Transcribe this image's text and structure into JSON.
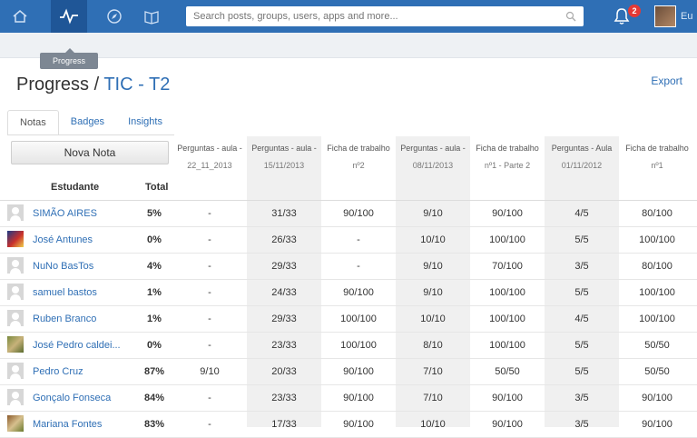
{
  "nav": {
    "tooltip": "Progress",
    "search_placeholder": "Search posts, groups, users, apps and more...",
    "notification_count": "2",
    "user_label": "Eu"
  },
  "page": {
    "title_prefix": "Progress / ",
    "course": "TIC - T2",
    "export_label": "Export",
    "nova_nota_label": "Nova Nota"
  },
  "tabs": [
    "Notas",
    "Badges",
    "Insights"
  ],
  "table": {
    "student_header": "Estudante",
    "total_header": "Total",
    "columns": [
      {
        "title": "Perguntas - aula -",
        "sub": "22_11_2013"
      },
      {
        "title": "Perguntas - aula -",
        "sub": "15/11/2013"
      },
      {
        "title": "Ficha de trabalho",
        "sub": "nº2"
      },
      {
        "title": "Perguntas - aula -",
        "sub": "08/11/2013"
      },
      {
        "title": "Ficha de trabalho",
        "sub": "nº1 - Parte 2"
      },
      {
        "title": "Perguntas - Aula",
        "sub": "01/11/2012"
      },
      {
        "title": "Ficha de trabalho",
        "sub": "nº1"
      }
    ],
    "rows": [
      {
        "name": "SIMÃO AIRES",
        "total": "5%",
        "avatar": "default",
        "scores": [
          "-",
          "31/33",
          "90/100",
          "9/10",
          "90/100",
          "4/5",
          "80/100"
        ]
      },
      {
        "name": "José Antunes",
        "total": "0%",
        "avatar": "photo2",
        "scores": [
          "-",
          "26/33",
          "-",
          "10/10",
          "100/100",
          "5/5",
          "100/100"
        ]
      },
      {
        "name": "NuNo BasTos",
        "total": "4%",
        "avatar": "default",
        "scores": [
          "-",
          "29/33",
          "-",
          "9/10",
          "70/100",
          "3/5",
          "80/100"
        ]
      },
      {
        "name": "samuel bastos",
        "total": "1%",
        "avatar": "default",
        "scores": [
          "-",
          "24/33",
          "90/100",
          "9/10",
          "100/100",
          "5/5",
          "100/100"
        ]
      },
      {
        "name": "Ruben Branco",
        "total": "1%",
        "avatar": "default",
        "scores": [
          "-",
          "29/33",
          "100/100",
          "10/10",
          "100/100",
          "4/5",
          "100/100"
        ]
      },
      {
        "name": "José Pedro caldei...",
        "total": "0%",
        "avatar": "photo",
        "scores": [
          "-",
          "23/33",
          "100/100",
          "8/10",
          "100/100",
          "5/5",
          "50/50"
        ]
      },
      {
        "name": "Pedro Cruz",
        "total": "87%",
        "avatar": "default",
        "scores": [
          "9/10",
          "20/33",
          "90/100",
          "7/10",
          "50/50",
          "5/5",
          "50/50"
        ]
      },
      {
        "name": "Gonçalo Fonseca",
        "total": "84%",
        "avatar": "default",
        "scores": [
          "-",
          "23/33",
          "90/100",
          "7/10",
          "90/100",
          "3/5",
          "90/100"
        ]
      },
      {
        "name": "Mariana Fontes",
        "total": "83%",
        "avatar": "photo3",
        "scores": [
          "-",
          "17/33",
          "90/100",
          "10/10",
          "90/100",
          "3/5",
          "90/100"
        ]
      }
    ]
  }
}
